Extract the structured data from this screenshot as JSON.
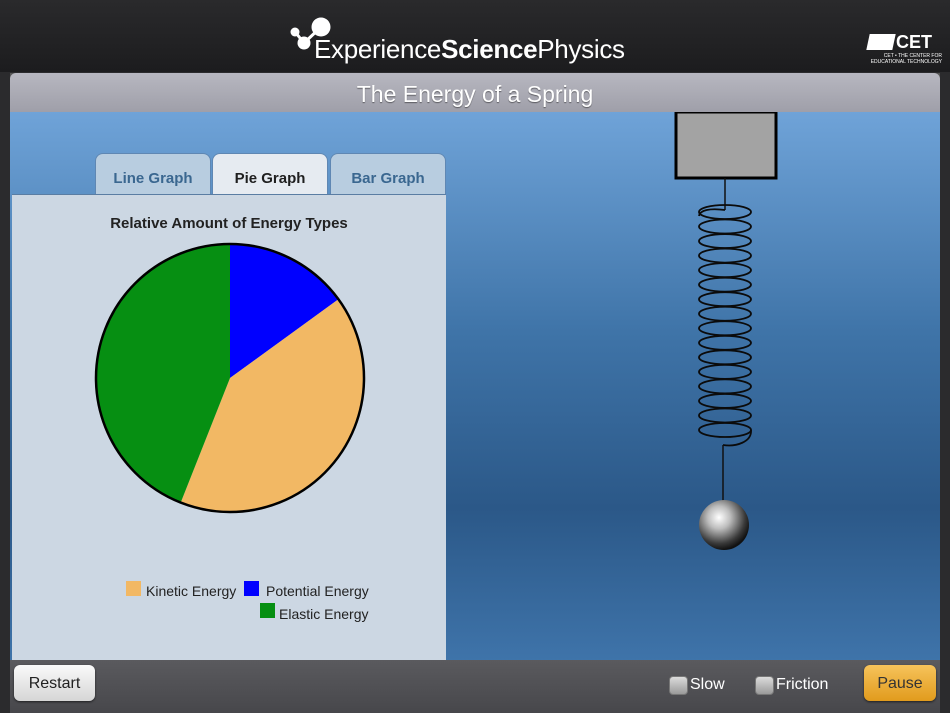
{
  "app": {
    "brand_light_1": "Experience",
    "brand_bold": "Science",
    "brand_light_2": "Physics",
    "publisher": "CET",
    "publisher_subtitle": "CET • THE CENTER FOR\nEDUCATIONAL TECHNOLOGY"
  },
  "title": "The Energy of a Spring",
  "tabs": [
    {
      "label": "Line Graph",
      "active": false
    },
    {
      "label": "Pie Graph",
      "active": true
    },
    {
      "label": "Bar Graph",
      "active": false
    }
  ],
  "chart_data": {
    "type": "pie",
    "title": "Relative Amount of Energy Types",
    "slices": [
      {
        "label": "Potential Energy",
        "value": 15,
        "color": "#0000ff"
      },
      {
        "label": "Kinetic Energy",
        "value": 41,
        "color": "#f2b864"
      },
      {
        "label": "Elastic Energy",
        "value": 44,
        "color": "#068f12"
      }
    ],
    "start": "top, clockwise",
    "legend_position": "bottom"
  },
  "legend": {
    "kinetic": "Kinetic Energy",
    "potential": "Potential Energy",
    "elastic": "Elastic Energy"
  },
  "controls": {
    "restart": "Restart",
    "slow": "Slow",
    "friction": "Friction",
    "pause": "Pause",
    "slow_checked": false,
    "friction_checked": false
  }
}
